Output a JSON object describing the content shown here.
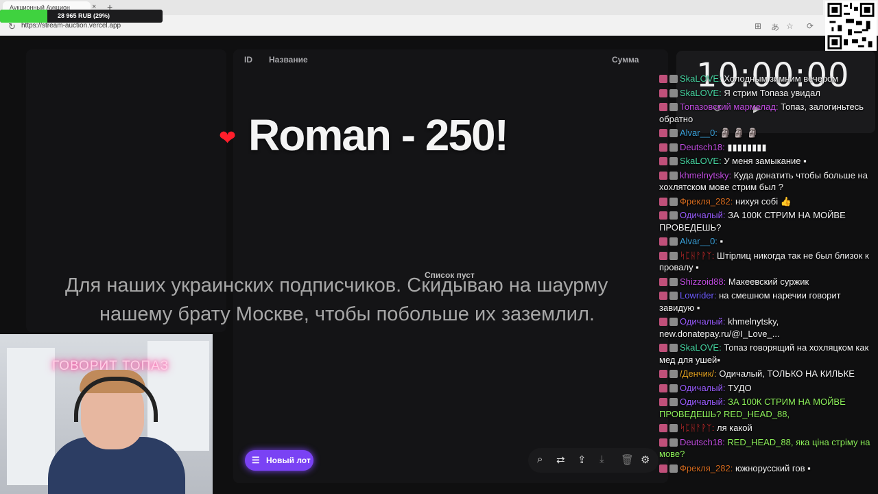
{
  "browser": {
    "tab_title": "Аукционный Аукцион",
    "tab_close": "×",
    "tab_new": "+",
    "url": "https://stream-auction.vercel.app",
    "faded_center_title": "",
    "faded_stats": [
      "",
      ""
    ]
  },
  "goal": {
    "text": "28 965 RUB (29%)",
    "fraction": 0.29,
    "color": "#3fd23f"
  },
  "table": {
    "col_id": "ID",
    "col_name": "Название",
    "col_sum": "Сумма",
    "empty_text": "Список пуст"
  },
  "winner": {
    "text": "Roman - 250!",
    "heart_icon": "heart-icon",
    "heart_color": "#ff1e2b"
  },
  "banner": {
    "line1": "Для наших украинских подписчиков. Скидываю на шаурму",
    "line2": "нашему брату Москве, чтобы побольше их заземлил."
  },
  "new_lot_button": {
    "label": "Новый лот",
    "icon": "playlist-add-icon",
    "color": "#7a42f4"
  },
  "toolbar_icons": [
    "search-icon",
    "shuffle-icon",
    "upload-icon",
    "download-icon",
    "trash-icon",
    "settings-icon"
  ],
  "timer": {
    "value": "10:00:00"
  },
  "webcam": {
    "neon_text": "ГОВОРИТ ТОПАЗ"
  },
  "chat": [
    {
      "user": "SkaLOVE:",
      "color": "#45d4a0",
      "text": "Холодным зимним вечером"
    },
    {
      "user": "SkaLOVE:",
      "color": "#45d4a0",
      "text": "Я стрим Топаза увидал"
    },
    {
      "user": "Топазовский мармелад:",
      "color": "#c04ce0",
      "text": "Топаз, залогиньтесь обратно"
    },
    {
      "user": "Alvar__0:",
      "color": "#3aa0d8",
      "text": "🗿 🗿 🗿"
    },
    {
      "user": "Deutsch18:",
      "color": "#c04ce0",
      "text": "▮▮▮▮▮▮▮▮"
    },
    {
      "user": "SkaLOVE:",
      "color": "#45d4a0",
      "text": "У меня замыкание ▪"
    },
    {
      "user": "khmelnytsky:",
      "color": "#c04ce0",
      "text": "Куда донатить чтобы больше на хохлятском мове стрим был ?"
    },
    {
      "user": "Фрекля_282:",
      "color": "#d2691e",
      "text": "нихуя собі 👍"
    },
    {
      "user": "Одичалый:",
      "color": "#9a5cff",
      "text": "ЗА 100К СТРИМ НА МОЙВЕ ПРОВЕДЕШЬ?"
    },
    {
      "user": "Alvar__0:",
      "color": "#3aa0d8",
      "text": "▪"
    },
    {
      "user": "ᛋᛈᚺᚨᚹᛉ:",
      "color": "#e03030",
      "text": "Штірлиц никогда так не был близок к провалу ▪"
    },
    {
      "user": "Shizzoid88:",
      "color": "#c04ce0",
      "text": "Макеевский суржик"
    },
    {
      "user": "Lowrider:",
      "color": "#6e5cff",
      "text": "на смешном наречии говорит завидую ▪"
    },
    {
      "user": "Одичалый:",
      "color": "#9a5cff",
      "text": "khmelnytsky, new.donatepay.ru/@I_Love_..."
    },
    {
      "user": "SkaLOVE:",
      "color": "#45d4a0",
      "text": "Топаз говорящий на хохляцком как мед для ушей▪"
    },
    {
      "user": "/Денчик/:",
      "color": "#e0a020",
      "text": "Одичалый, ТОЛЬКО НА КИЛЬКЕ"
    },
    {
      "user": "Одичалый:",
      "color": "#9a5cff",
      "text": "ТУДО"
    },
    {
      "user": "Одичалый:",
      "color": "#9a5cff",
      "text": "ЗА 100К СТРИМ НА МОЙВЕ ПРОВЕДЕШЬ? RED_HEAD_88,",
      "text_color": "#8df05a"
    },
    {
      "user": "ᛋᛈᚺᚨᚹᛉ:",
      "color": "#e03030",
      "text": "ля какой"
    },
    {
      "user": "Deutsch18:",
      "color": "#c04ce0",
      "text": "RED_HEAD_88, яка ціна стріму на мове?",
      "text_color": "#8df05a"
    },
    {
      "user": "Фрекля_282:",
      "color": "#d2691e",
      "text": "южнорусский гов ▪"
    }
  ]
}
